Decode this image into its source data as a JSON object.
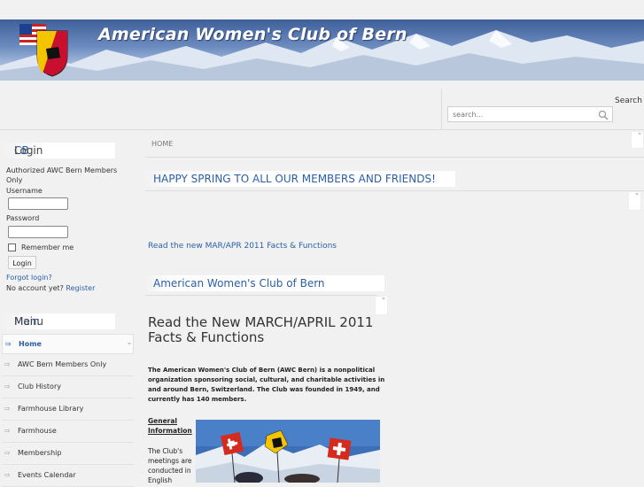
{
  "header": {
    "site_title": "American Women's Club of Bern"
  },
  "search": {
    "label": "Search",
    "placeholder": "search..."
  },
  "login": {
    "title_accent": "CB",
    "title_rest": " Login",
    "intro": "Authorized AWC Bern Members Only",
    "username_label": "Username",
    "password_label": "Password",
    "remember_label": "Remember me",
    "button": "Login",
    "forgot": "Forgot login?",
    "no_account": "No account yet?",
    "register": "Register"
  },
  "main_menu": {
    "title_accent": "Main",
    "title_rest": " Menu",
    "items": [
      {
        "label": "Home"
      },
      {
        "label": "AWC Bern Members Only"
      },
      {
        "label": "Club History"
      },
      {
        "label": "Farmhouse Library"
      },
      {
        "label": "Farmhouse"
      },
      {
        "label": "Membership"
      },
      {
        "label": "Events Calendar"
      }
    ]
  },
  "content": {
    "breadcrumb": "HOME",
    "heading1": "HAPPY SPRING TO ALL OUR MEMBERS AND FRIENDS!",
    "facts_link": "Read the new MAR/APR 2011 Facts &  Functions",
    "heading2": "American Women's Club of Bern",
    "article_title": "Read the New MARCH/APRIL 2011 Facts & Functions",
    "intro_paragraph": "The American Women's Club of Bern (AWC Bern) is a nonpolitical organization sponsoring social, cultural, and charitable activities in and around Bern, Switzerland. The Club was founded in 1949, and currently has 140 members.",
    "general_info": "General Information",
    "meetings_text": "The Club's meetings are conducted in English"
  },
  "colors": {
    "accent": "#2a5fa8",
    "background": "#f1f1f1"
  },
  "icons": {
    "search": "magnifier-icon",
    "menu_arrow": "arrow-right-icon"
  }
}
